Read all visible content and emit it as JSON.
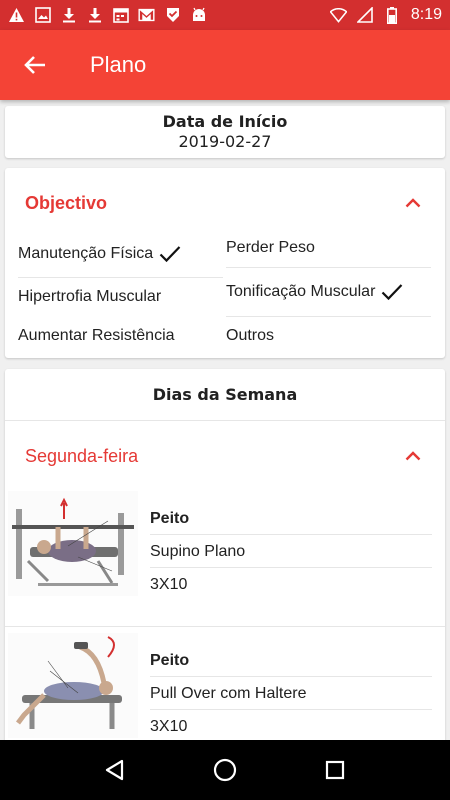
{
  "status_bar": {
    "time": "8:19",
    "icons_left": [
      "warning-icon",
      "image-icon",
      "download-icon",
      "download-icon",
      "calendar-icon",
      "gmail-icon",
      "check-flag-icon",
      "android-icon"
    ],
    "icons_right": [
      "wifi-icon",
      "signal-icon",
      "battery-icon"
    ]
  },
  "app_bar": {
    "title": "Plano",
    "color": "#f44336"
  },
  "start_date": {
    "label": "Data de Início",
    "value": "2019-02-27"
  },
  "objective": {
    "title": "Objectivo",
    "options": [
      {
        "label": "Manutenção Física",
        "checked": true
      },
      {
        "label": "Perder Peso",
        "checked": false
      },
      {
        "label": "Hipertrofia Muscular",
        "checked": false
      },
      {
        "label": "Tonificação Muscular",
        "checked": true
      },
      {
        "label": "Aumentar Resistência",
        "checked": false
      },
      {
        "label": "Outros",
        "checked": false
      }
    ]
  },
  "week": {
    "title": "Dias da Semana",
    "day": "Segunda-feira",
    "exercises": [
      {
        "group": "Peito",
        "name": "Supino Plano",
        "sets": "3X10"
      },
      {
        "group": "Peito",
        "name": "Pull Over com Haltere",
        "sets": "3X10"
      }
    ]
  },
  "accent": "#e53935"
}
